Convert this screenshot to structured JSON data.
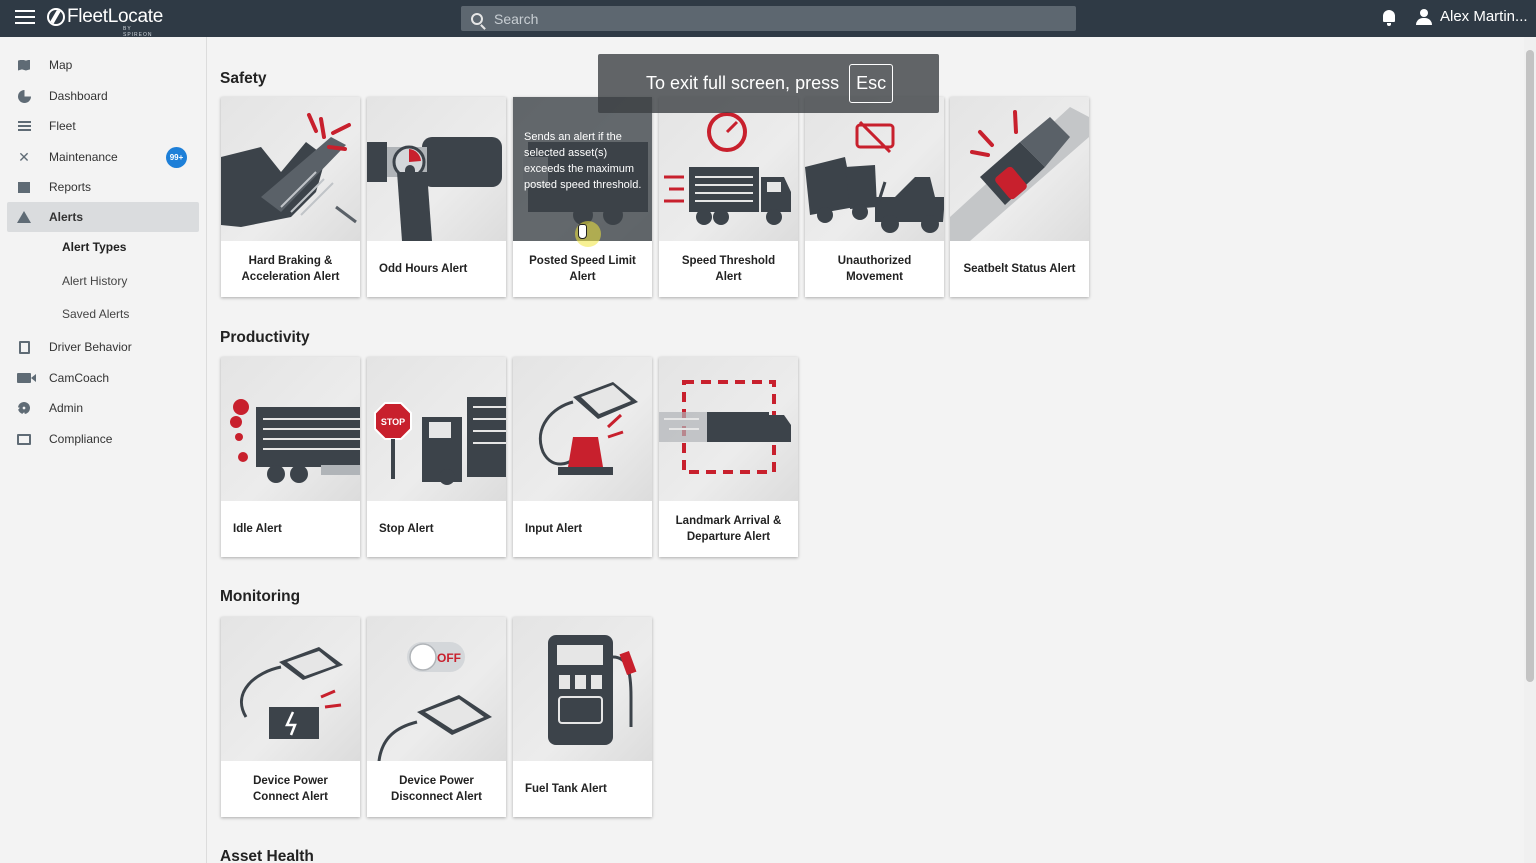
{
  "app": {
    "brand": "FleetLocate",
    "brand_sub": "BY SPIREON",
    "search_placeholder": "Search",
    "user_name": "Alex Martin..."
  },
  "sidebar": {
    "items": [
      {
        "label": "Map",
        "icon": "map-icon"
      },
      {
        "label": "Dashboard",
        "icon": "pie-chart-icon"
      },
      {
        "label": "Fleet",
        "icon": "list-icon"
      },
      {
        "label": "Maintenance",
        "icon": "wrench-icon",
        "badge": "99+"
      },
      {
        "label": "Reports",
        "icon": "report-icon"
      },
      {
        "label": "Alerts",
        "icon": "warning-icon",
        "active": true
      },
      {
        "label": "Driver Behavior",
        "icon": "clipboard-icon"
      },
      {
        "label": "CamCoach",
        "icon": "camera-icon"
      },
      {
        "label": "Admin",
        "icon": "gear-icon"
      },
      {
        "label": "Compliance",
        "icon": "id-card-icon"
      }
    ],
    "alerts_sub": [
      "Alert Types",
      "Alert History",
      "Saved Alerts"
    ]
  },
  "sections": [
    {
      "title": "Safety",
      "tiles": [
        "Hard Braking & Acceleration Alert",
        "Odd Hours Alert",
        "Posted Speed Limit Alert",
        "Speed Threshold Alert",
        "Unauthorized Movement",
        "Seatbelt Status Alert"
      ]
    },
    {
      "title": "Productivity",
      "tiles": [
        "Idle Alert",
        "Stop Alert",
        "Input Alert",
        "Landmark Arrival & Departure Alert"
      ]
    },
    {
      "title": "Monitoring",
      "tiles": [
        "Device Power Connect Alert",
        "Device Power Disconnect Alert",
        "Fuel Tank Alert"
      ]
    },
    {
      "title": "Asset Health",
      "tiles": []
    }
  ],
  "hover_text": "Sends an alert if the selected asset(s) exceeds the maximum posted speed threshold.",
  "illustration_text": {
    "stop_sign": "STOP",
    "off_toggle": "OFF"
  },
  "fullscreen": {
    "message": "To exit full screen, press",
    "key": "Esc"
  },
  "colors": {
    "topbar": "#2f3a45",
    "accent_red": "#c8202d",
    "badge_blue": "#1d7fd8",
    "illustration_dark": "#3c434a"
  }
}
